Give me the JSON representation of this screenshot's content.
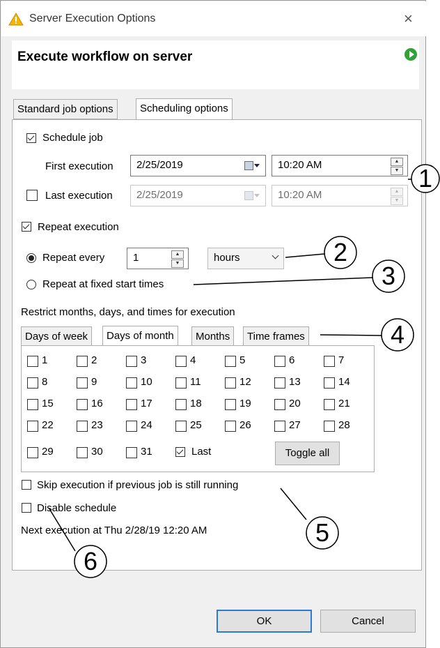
{
  "window": {
    "title": "Server Execution Options",
    "close_glyph": "×"
  },
  "header": {
    "title": "Execute workflow on server"
  },
  "tabs": [
    "Standard job options",
    "Scheduling options"
  ],
  "schedule": {
    "schedule_job_label": "Schedule job",
    "first_execution_label": "First execution",
    "first_date": "2/25/2019",
    "first_time": "10:20 AM",
    "last_execution_label": "Last execution",
    "last_date": "2/25/2019",
    "last_time": "10:20 AM",
    "repeat_execution_label": "Repeat execution",
    "repeat_every_label": "Repeat every",
    "repeat_value": "1",
    "repeat_unit": "hours",
    "repeat_fixed_label": "Repeat at fixed start times",
    "restrict_label": "Restrict months, days, and times for execution"
  },
  "restrict_tabs": [
    "Days of week",
    "Days of month",
    "Months",
    "Time frames"
  ],
  "days": [
    "1",
    "2",
    "3",
    "4",
    "5",
    "6",
    "7",
    "8",
    "9",
    "10",
    "11",
    "12",
    "13",
    "14",
    "15",
    "16",
    "17",
    "18",
    "19",
    "20",
    "21",
    "22",
    "23",
    "24",
    "25",
    "26",
    "27",
    "28",
    "29",
    "30",
    "31"
  ],
  "last_label": "Last",
  "toggle_all_label": "Toggle all",
  "skip_label": "Skip execution if previous job is still running",
  "disable_label": "Disable schedule",
  "next_execution_text": "Next execution at Thu 2/28/19 12:20 AM",
  "buttons": {
    "ok": "OK",
    "cancel": "Cancel"
  },
  "callouts": [
    "1",
    "2",
    "3",
    "4",
    "5",
    "6"
  ],
  "icons": {
    "title": "warning-triangle-icon",
    "run": "play-icon",
    "calendar": "calendar-icon"
  },
  "colors": {
    "accent": "#2b7bd6",
    "run_green": "#2fa336",
    "warning_yellow": "#f4b400"
  }
}
